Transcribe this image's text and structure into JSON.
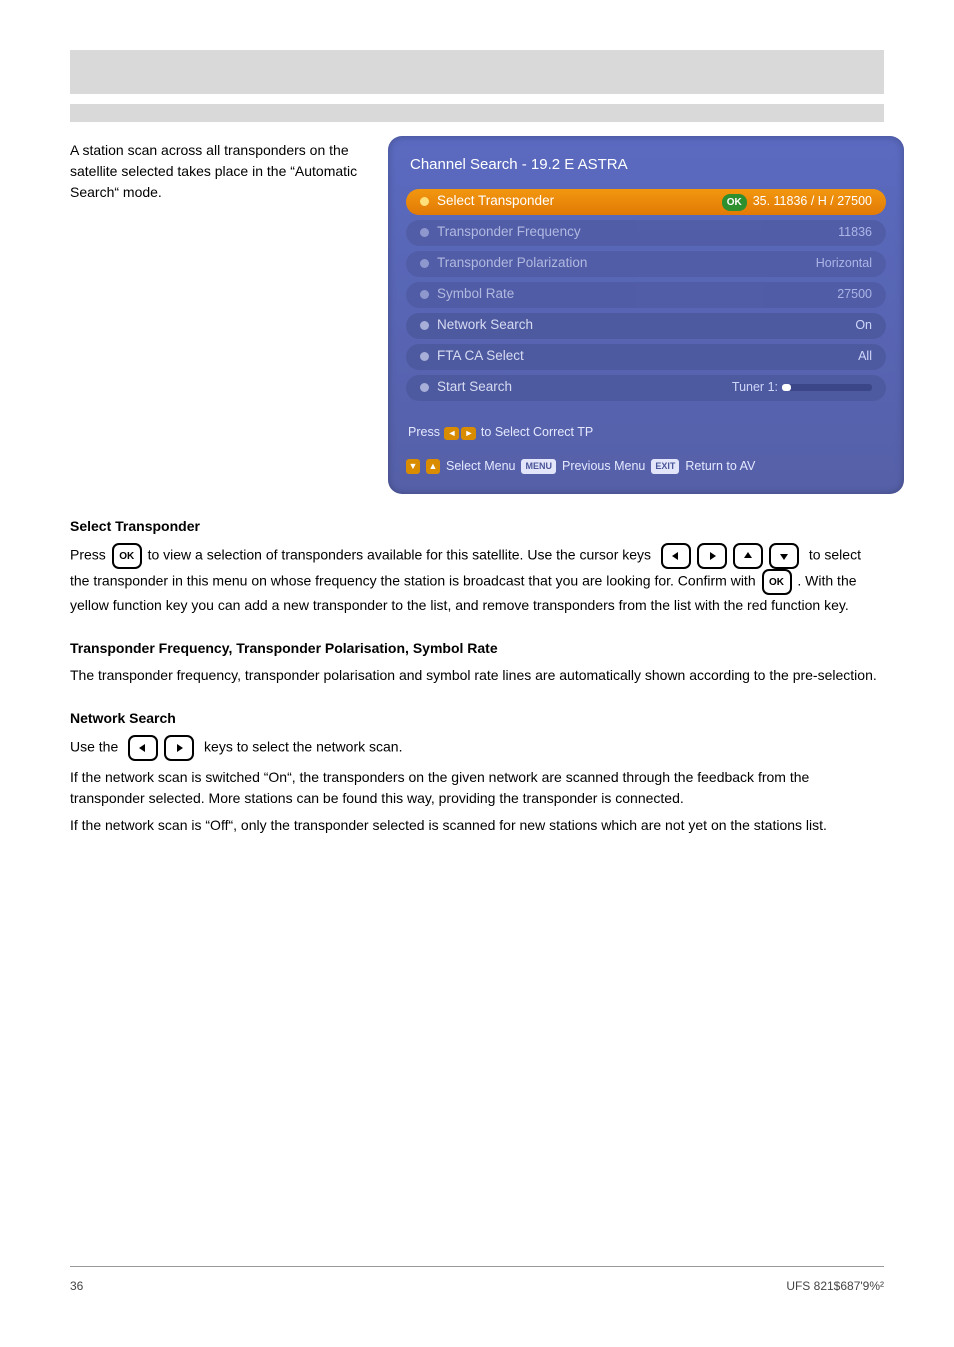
{
  "bars": {
    "title_placeholder": "",
    "subtitle_placeholder": ""
  },
  "intro": "A station scan across all transponders on the satellite selected takes place in the “Automatic Search“ mode.",
  "osd": {
    "title": "Channel Search - 19.2 E ASTRA",
    "rows": [
      {
        "id": "select-tp",
        "label": "Select Transponder",
        "value": "35. 11836 / H / 27500",
        "selected": true,
        "ok": true
      },
      {
        "id": "tp-freq",
        "label": "Transponder Frequency",
        "value": "11836",
        "disabled": true
      },
      {
        "id": "tp-pol",
        "label": "Transponder Polarization",
        "value": "Horizontal",
        "disabled": true
      },
      {
        "id": "sym-rate",
        "label": "Symbol Rate",
        "value": "27500",
        "disabled": true
      },
      {
        "id": "net-search",
        "label": "Network Search",
        "value": "On"
      },
      {
        "id": "fta-ca",
        "label": "FTA CA Select",
        "value": "All"
      },
      {
        "id": "start",
        "label": "Start Search",
        "value": "Tuner 1:",
        "bar": true
      }
    ],
    "hint_prefix": "Press",
    "hint_suffix": "to Select Correct TP",
    "footer": {
      "select": "Select Menu",
      "menu": "Previous Menu",
      "exit": "Return to AV",
      "menu_key": "MENU",
      "exit_key": "EXIT"
    }
  },
  "body": [
    {
      "type": "subhead",
      "text": "Select Transponder"
    },
    {
      "type": "para",
      "html": "Press [OK] to view a selection of transponders available for this satellite. Use the cursor keys [LRUD] to select the transponder in this menu on whose frequency the station is broadcast that you are looking for. Confirm with [OK] . With the yellow function key you can add a new transponder to the list, and remove transponders from the list with the red function key."
    },
    {
      "type": "subhead",
      "text": "Transponder Frequency, Transponder Polarisation, Symbol Rate"
    },
    {
      "type": "para",
      "text": "The transponder frequency, transponder polarisation and symbol rate lines are automatically shown according to the pre-selection."
    },
    {
      "type": "subhead",
      "text": "Network Search"
    },
    {
      "type": "para",
      "html": "Use the [LR] keys to select the network scan."
    },
    {
      "type": "para",
      "text": "If the network scan is switched “On“, the transponders on the given network are scanned through the feedback from the transponder selected. More stations can be found this way, providing the transponder is connected."
    },
    {
      "type": "para",
      "text": "If the network scan is “Off“, only the transponder selected is scanned for new stations which are not yet on the stations list."
    }
  ],
  "footer": {
    "left": "36",
    "right": "UFS 821$687'9%²"
  }
}
